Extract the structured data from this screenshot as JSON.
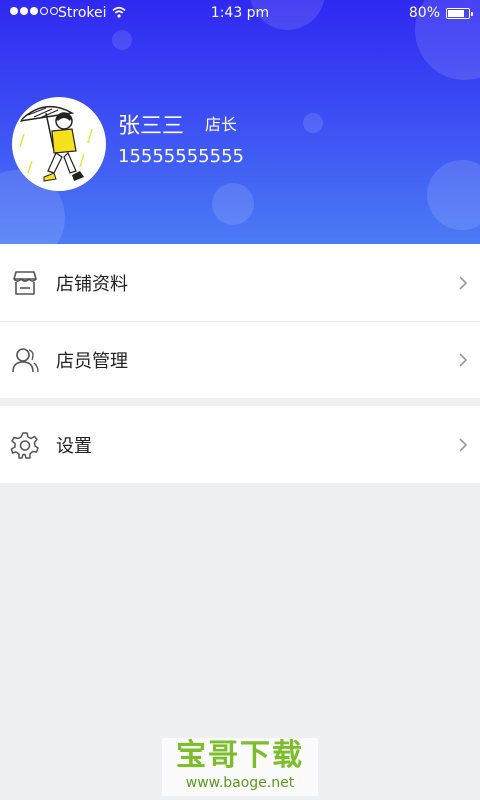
{
  "status_bar": {
    "carrier": "Strokei",
    "time": "1:43 pm",
    "battery": "80%",
    "battery_level": 0.8
  },
  "profile": {
    "name": "张三三",
    "role": "店长",
    "phone": "15555555555"
  },
  "menu": {
    "store_info": {
      "label": "店铺资料",
      "icon": "store-icon"
    },
    "staff": {
      "label": "店员管理",
      "icon": "person-icon"
    },
    "settings": {
      "label": "设置",
      "icon": "gear-icon"
    }
  },
  "watermark": {
    "title": "宝哥下载",
    "url": "www.baoge.net"
  },
  "colors": {
    "header_top": "#2f28f2",
    "header_bottom": "#4b7bf5",
    "page_background": "#eff0f4",
    "watermark_green": "#7bbd2a"
  }
}
